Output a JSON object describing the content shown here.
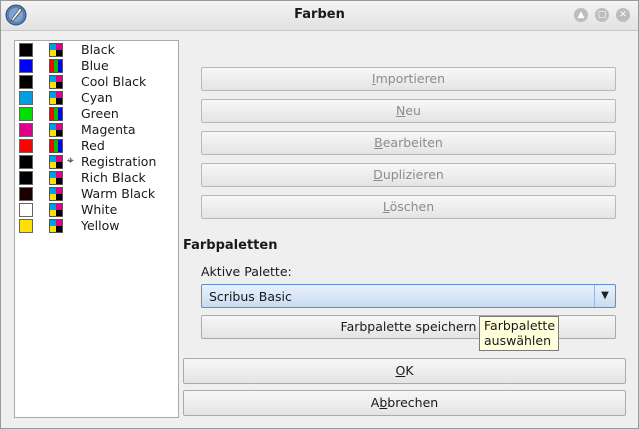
{
  "window": {
    "title": "Farben"
  },
  "colors": [
    {
      "name": "Black",
      "swatch": "#000000",
      "type": "cmyk"
    },
    {
      "name": "Blue",
      "swatch": "#0000ff",
      "type": "rgb"
    },
    {
      "name": "Cool Black",
      "swatch": "#000000",
      "type": "cmyk"
    },
    {
      "name": "Cyan",
      "swatch": "#00a0e0",
      "type": "cmyk"
    },
    {
      "name": "Green",
      "swatch": "#00e000",
      "type": "rgb"
    },
    {
      "name": "Magenta",
      "swatch": "#e0008c",
      "type": "cmyk"
    },
    {
      "name": "Red",
      "swatch": "#ff0000",
      "type": "rgb"
    },
    {
      "name": "Registration",
      "swatch": "#000000",
      "type": "cmyk",
      "registration": true
    },
    {
      "name": "Rich Black",
      "swatch": "#000000",
      "type": "cmyk"
    },
    {
      "name": "Warm Black",
      "swatch": "#1a0000",
      "type": "cmyk"
    },
    {
      "name": "White",
      "swatch": "#ffffff",
      "type": "cmyk"
    },
    {
      "name": "Yellow",
      "swatch": "#ffe000",
      "type": "cmyk"
    }
  ],
  "buttons": {
    "importieren": {
      "pre": "",
      "u": "I",
      "post": "mportieren"
    },
    "neu": {
      "pre": "",
      "u": "N",
      "post": "eu"
    },
    "bearbeiten": {
      "pre": "",
      "u": "B",
      "post": "earbeiten"
    },
    "duplizieren": {
      "pre": "",
      "u": "D",
      "post": "uplizieren"
    },
    "loeschen": {
      "pre": "",
      "u": "L",
      "post": "öschen"
    },
    "save_palette": "Farbpalette speichern",
    "ok": {
      "pre": "",
      "u": "O",
      "post": "K"
    },
    "cancel": {
      "pre": "A",
      "u": "b",
      "post": "brechen"
    }
  },
  "palettes": {
    "section_title": "Farbpaletten",
    "active_label": "Aktive Palette:",
    "active_value": "Scribus Basic",
    "tooltip_line1": "Farbpalette",
    "tooltip_line2": "auswählen"
  }
}
